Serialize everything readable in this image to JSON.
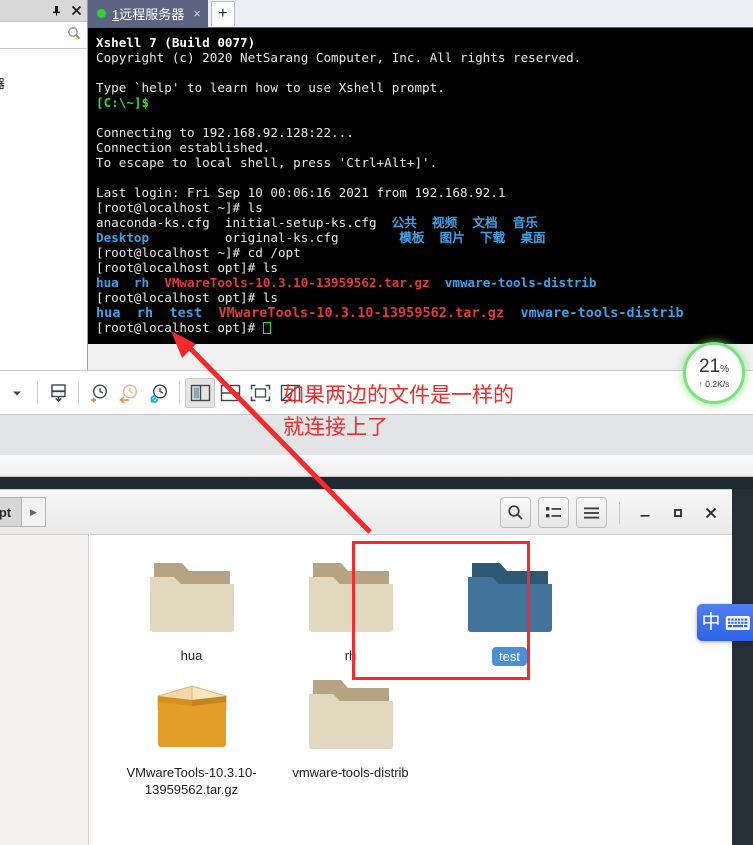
{
  "left_panel": {
    "pin_icon": "pin-icon",
    "close_icon": "close-icon",
    "search_placeholder": "",
    "search_value": "",
    "search_icon": "search-icon",
    "tree_item": "器"
  },
  "xshell": {
    "tab": {
      "number": "1",
      "title": "远程服务器",
      "close_label": "×",
      "status_dot": "green"
    },
    "new_tab_label": "+",
    "terminal_lines": [
      {
        "segs": [
          {
            "t": "Xshell 7 (Build 0077)",
            "c": "t-wb"
          }
        ]
      },
      {
        "segs": [
          {
            "t": "Copyright (c) 2020 NetSarang Computer, Inc. All rights reserved.",
            "c": "t-w"
          }
        ]
      },
      {
        "segs": [
          {
            "t": "",
            "c": "t-w"
          }
        ]
      },
      {
        "segs": [
          {
            "t": "Type `help' to learn how to use Xshell prompt.",
            "c": "t-w"
          }
        ]
      },
      {
        "segs": [
          {
            "t": "[C:\\~]$",
            "c": "t-g"
          }
        ]
      },
      {
        "segs": [
          {
            "t": "",
            "c": "t-w"
          }
        ]
      },
      {
        "segs": [
          {
            "t": "Connecting to 192.168.92.128:22...",
            "c": "t-w"
          }
        ]
      },
      {
        "segs": [
          {
            "t": "Connection established.",
            "c": "t-w"
          }
        ]
      },
      {
        "segs": [
          {
            "t": "To escape to local shell, press 'Ctrl+Alt+]'.",
            "c": "t-w"
          }
        ]
      },
      {
        "segs": [
          {
            "t": "",
            "c": "t-w"
          }
        ]
      },
      {
        "segs": [
          {
            "t": "Last login: Fri Sep 10 00:06:16 2021 from 192.168.92.1",
            "c": "t-w"
          }
        ]
      },
      {
        "segs": [
          {
            "t": "[root@localhost ~]# ls",
            "c": "t-w"
          }
        ]
      },
      {
        "segs": [
          {
            "t": "anaconda-ks.cfg  initial-setup-ks.cfg  ",
            "c": "t-w"
          },
          {
            "t": "公共  视频  文档  音乐",
            "c": "t-b"
          }
        ]
      },
      {
        "segs": [
          {
            "t": "Desktop",
            "c": "t-b"
          },
          {
            "t": "          original-ks.cfg        ",
            "c": "t-w"
          },
          {
            "t": "模板  图片  下载  桌面",
            "c": "t-b"
          }
        ]
      },
      {
        "segs": [
          {
            "t": "[root@localhost ~]# cd /opt",
            "c": "t-w"
          }
        ]
      },
      {
        "segs": [
          {
            "t": "[root@localhost opt]# ls",
            "c": "t-w"
          }
        ]
      },
      {
        "segs": [
          {
            "t": "hua  rh  ",
            "c": "t-b"
          },
          {
            "t": "VMwareTools-10.3.10-13959562.tar.gz",
            "c": "t-r"
          },
          {
            "t": "  ",
            "c": "t-w"
          },
          {
            "t": "vmware-tools-distrib",
            "c": "t-b"
          }
        ]
      },
      {
        "segs": [
          {
            "t": "[root@localhost opt]# ls",
            "c": "t-w"
          }
        ]
      },
      {
        "segs": [
          {
            "t": "hua  rh  test  ",
            "c": "t-b t-big"
          },
          {
            "t": "VMwareTools-10.3.10-13959562.tar.gz",
            "c": "t-r t-big"
          },
          {
            "t": "  ",
            "c": "t-w t-big"
          },
          {
            "t": "vmware-tools-distrib",
            "c": "t-b t-big"
          }
        ]
      },
      {
        "segs": [
          {
            "t": "[root@localhost opt]# ",
            "c": "t-w"
          },
          {
            "cursor": true
          }
        ]
      }
    ]
  },
  "toolbar": {
    "icons": [
      {
        "name": "dropdown-arrow-icon",
        "glyph": "▾"
      },
      {
        "name": "transfer-download-icon",
        "glyph": ""
      },
      {
        "name": "history-add-icon",
        "glyph": ""
      },
      {
        "name": "history-back-icon",
        "glyph": ""
      },
      {
        "name": "history-settings-icon",
        "glyph": ""
      },
      {
        "name": "layout-vertical-split-icon",
        "glyph": ""
      },
      {
        "name": "layout-horizontal-split-icon",
        "glyph": ""
      },
      {
        "name": "layout-fullscreen-icon",
        "glyph": ""
      },
      {
        "name": "layout-hide-icon",
        "glyph": ""
      }
    ]
  },
  "speed_widget": {
    "percent": "21",
    "percent_unit": "%",
    "up_arrow": "↑",
    "rate": "0.2K/s"
  },
  "annotation": {
    "line1": "如果两边的文件是一样的",
    "line2": "就连接上了",
    "color": "#ee2d2d"
  },
  "file_manager": {
    "path_crumb": "pt",
    "path_next_glyph": "▶",
    "buttons": [
      {
        "name": "search-button",
        "icon": "search-icon"
      },
      {
        "name": "view-list-button",
        "icon": "list-view-icon"
      },
      {
        "name": "menu-button",
        "icon": "hamburger-menu-icon"
      }
    ],
    "window_buttons": [
      {
        "name": "minimize-button",
        "glyph": "–"
      },
      {
        "name": "maximize-button",
        "glyph": "▫"
      },
      {
        "name": "close-button",
        "glyph": "✕"
      }
    ],
    "items": [
      {
        "label": "hua",
        "type": "folder",
        "selected": false
      },
      {
        "label": "rh",
        "type": "folder",
        "selected": false
      },
      {
        "label": "test",
        "type": "folder",
        "selected": true
      },
      {
        "label": "VMwareTools-10.3.10-13959562.tar.gz",
        "type": "archive",
        "selected": false
      },
      {
        "label": "vmware-tools-distrib",
        "type": "folder",
        "selected": false
      }
    ]
  },
  "ime": {
    "mode": "中",
    "keyboard_icon": "keyboard-icon"
  }
}
